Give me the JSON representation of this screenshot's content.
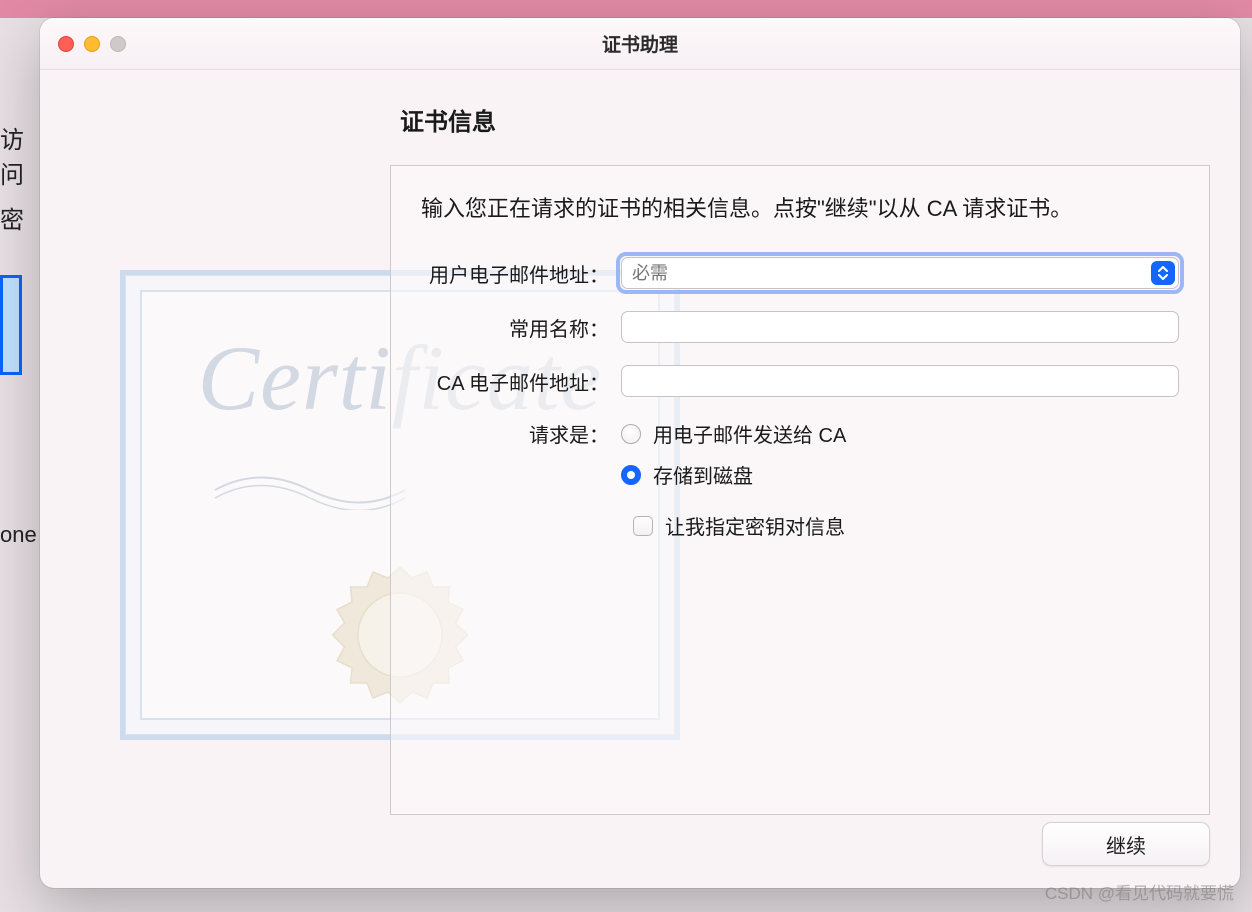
{
  "background": {
    "partial1": "访问",
    "partial2": "密",
    "partial3": "one"
  },
  "window": {
    "title": "证书助理"
  },
  "page": {
    "heading": "证书信息",
    "description": "输入您正在请求的证书的相关信息。点按\"继续\"以从 CA 请求证书。"
  },
  "form": {
    "email_label": "用户电子邮件地址：",
    "email_placeholder": "必需",
    "common_name_label": "常用名称：",
    "ca_email_label": "CA 电子邮件地址：",
    "request_label": "请求是：",
    "radio_email": "用电子邮件发送给 CA",
    "radio_disk": "存储到磁盘",
    "checkbox_keypair": "让我指定密钥对信息"
  },
  "illustration": {
    "script": "Certificate"
  },
  "buttons": {
    "continue": "继续"
  },
  "watermark": "CSDN @看见代码就要慌"
}
